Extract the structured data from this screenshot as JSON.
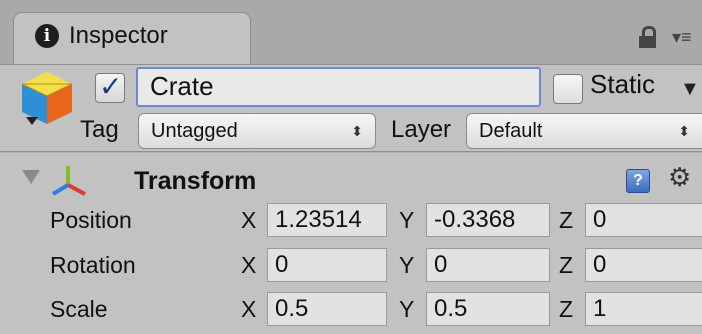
{
  "tab": {
    "title": "Inspector",
    "info_icon": "i"
  },
  "header": {
    "name": "Crate",
    "static_label": "Static",
    "tag_label": "Tag",
    "tag_value": "Untagged",
    "layer_label": "Layer",
    "layer_value": "Default"
  },
  "transform": {
    "title": "Transform",
    "help_icon": "?",
    "rows": [
      {
        "label": "Position",
        "x": "1.23514",
        "y": "-0.3368",
        "z": "0"
      },
      {
        "label": "Rotation",
        "x": "0",
        "y": "0",
        "z": "0"
      },
      {
        "label": "Scale",
        "x": "0.5",
        "y": "0.5",
        "z": "1"
      }
    ],
    "axis_x": "X",
    "axis_y": "Y",
    "axis_z": "Z"
  },
  "colors": {
    "accent_border": "#6d8cd0",
    "panel_bg": "#c2c2c2",
    "tab_strip": "#a9a9a9"
  }
}
